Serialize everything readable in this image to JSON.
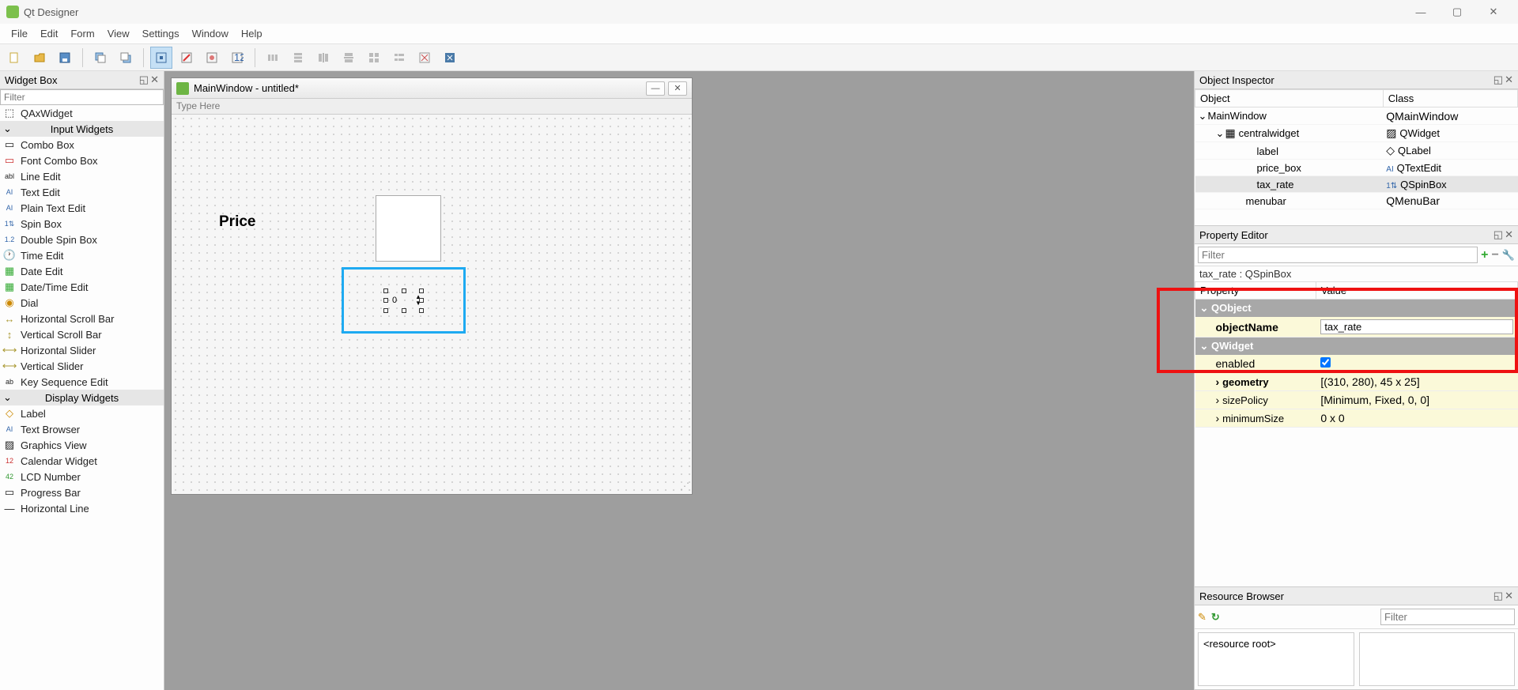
{
  "app": {
    "title": "Qt Designer"
  },
  "menu": [
    "File",
    "Edit",
    "Form",
    "View",
    "Settings",
    "Window",
    "Help"
  ],
  "widget_box": {
    "title": "Widget Box",
    "filter_placeholder": "Filter",
    "top_item": "QAxWidget",
    "cat_input": "Input Widgets",
    "input_items": [
      "Combo Box",
      "Font Combo Box",
      "Line Edit",
      "Text Edit",
      "Plain Text Edit",
      "Spin Box",
      "Double Spin Box",
      "Time Edit",
      "Date Edit",
      "Date/Time Edit",
      "Dial",
      "Horizontal Scroll Bar",
      "Vertical Scroll Bar",
      "Horizontal Slider",
      "Vertical Slider",
      "Key Sequence Edit"
    ],
    "cat_display": "Display Widgets",
    "display_items": [
      "Label",
      "Text Browser",
      "Graphics View",
      "Calendar Widget",
      "LCD Number",
      "Progress Bar",
      "Horizontal Line"
    ]
  },
  "form": {
    "title": "MainWindow - untitled*",
    "menubar_hint": "Type Here",
    "price_label": "Price",
    "spin_value": "0"
  },
  "object_inspector": {
    "title": "Object Inspector",
    "col_object": "Object",
    "col_class": "Class",
    "rows": [
      {
        "obj": "MainWindow",
        "cls": "QMainWindow"
      },
      {
        "obj": "centralwidget",
        "cls": "QWidget"
      },
      {
        "obj": "label",
        "cls": "QLabel"
      },
      {
        "obj": "price_box",
        "cls": "QTextEdit"
      },
      {
        "obj": "tax_rate",
        "cls": "QSpinBox"
      },
      {
        "obj": "menubar",
        "cls": "QMenuBar"
      }
    ]
  },
  "property_editor": {
    "title": "Property Editor",
    "filter_placeholder": "Filter",
    "context": "tax_rate : QSpinBox",
    "col_property": "Property",
    "col_value": "Value",
    "group_qobject": "QObject",
    "objectName_key": "objectName",
    "objectName_val": "tax_rate",
    "group_qwidget": "QWidget",
    "enabled_key": "enabled",
    "geometry_key": "geometry",
    "geometry_val": "[(310, 280), 45 x 25]",
    "sizePolicy_key": "sizePolicy",
    "sizePolicy_val": "[Minimum, Fixed, 0, 0]",
    "minimumSize_key": "minimumSize",
    "minimumSize_val": "0 x 0"
  },
  "resource_browser": {
    "title": "Resource Browser",
    "filter_placeholder": "Filter",
    "root": "<resource root>"
  }
}
